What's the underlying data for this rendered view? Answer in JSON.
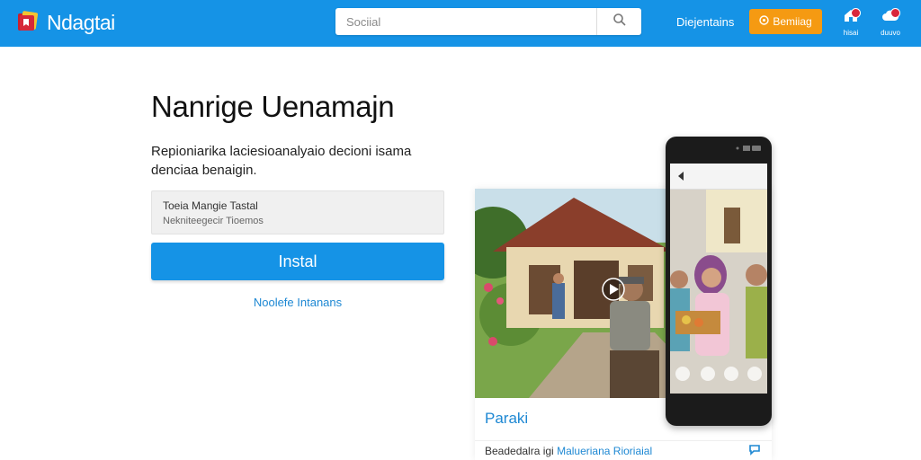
{
  "header": {
    "brand": "Ndagtai",
    "search_placeholder": "Sociial",
    "nav_link": "Diejentains",
    "cta_label": "Bemiiag",
    "icons": [
      {
        "name": "home-icon",
        "label": "hisai"
      },
      {
        "name": "cloud-icon",
        "label": "duuvo"
      }
    ]
  },
  "hero": {
    "headline": "Nanrige Uenamajn",
    "subtext": "Repioniarika laciesioanalyaio decioni isama denciaa benaigin.",
    "info_line1": "Toeia Mangie Tastal",
    "info_line2": "Nekniteegecir Tioemos",
    "install_label": "Instal",
    "secondary_link": "Noolefe Intanans"
  },
  "card": {
    "title": "Paraki",
    "footer_text": "Beadedalra igi",
    "footer_highlight": "Malueriana Rioriaial"
  },
  "colors": {
    "header_bg": "#1593e6",
    "cta": "#f59a12",
    "accent": "#1e88d3",
    "badge": "#d9273b"
  }
}
